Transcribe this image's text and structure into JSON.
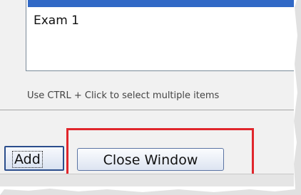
{
  "list": {
    "items": [
      "Exam 1"
    ]
  },
  "hint_text": "Use CTRL + Click to select multiple items",
  "buttons": {
    "add_label": "Add",
    "close_label": "Close Window"
  },
  "colors": {
    "highlight": "#e0262c",
    "selection": "#3169c6"
  }
}
